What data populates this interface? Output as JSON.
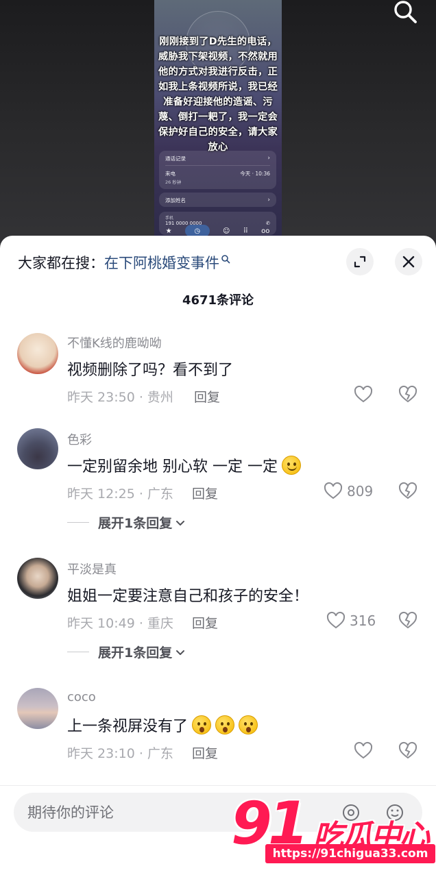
{
  "video": {
    "overlay_text": "刚刚接到了D先生的电话，威胁我下架视频，不然就用他的方式对我进行反击，正如我上条视频所说，我已经准备好迎接他的造谣、污蔑、倒打一耙了，我一定会保护好自己的安全，请大家放心",
    "call_log_label": "通话记录",
    "call_type": "来电",
    "call_time": "今天 · 10:36",
    "call_duration": "26 秒钟",
    "add_name_label": "添加姓名",
    "number_label": "手机",
    "number_value": "191 0000 0000"
  },
  "header": {
    "hot_search_prefix": "大家都在搜：",
    "hot_search_keyword": "在下阿桃婚变事件",
    "comment_count": "4671条评论"
  },
  "comments": [
    {
      "user": "不懂K线的鹿呦呦",
      "text": "视频删除了吗？看不到了",
      "meta": "昨天 23:50 · 贵州",
      "reply_label": "回复",
      "likes": ""
    },
    {
      "user": "色彩",
      "text": "一定别留余地 别心软 一定 一定",
      "meta": "昨天 12:25 · 广东",
      "reply_label": "回复",
      "likes": "809",
      "expand_label": "展开1条回复"
    },
    {
      "user": "平淡是真",
      "text": "姐姐一定要注意自己和孩子的安全！",
      "meta": "昨天 10:49 · 重庆",
      "reply_label": "回复",
      "likes": "316",
      "expand_label": "展开1条回复"
    },
    {
      "user": "coco",
      "text": "上一条视屏没有了",
      "meta": "昨天 23:10 · 广东",
      "reply_label": "回复",
      "likes": ""
    }
  ],
  "input": {
    "placeholder": "期待你的评论"
  },
  "watermark": {
    "number": "91",
    "name": "吃瓜中心",
    "url": "https://91chigua33.com"
  },
  "colors": {
    "accent_keyword": "#2a4a7a",
    "watermark_red": "#ff1a53",
    "sheet_bg": "#ffffff"
  },
  "icons": [
    "search-icon",
    "expand-icon",
    "close-icon",
    "heart-icon",
    "broken-heart-icon",
    "at-icon",
    "emoji-icon"
  ]
}
